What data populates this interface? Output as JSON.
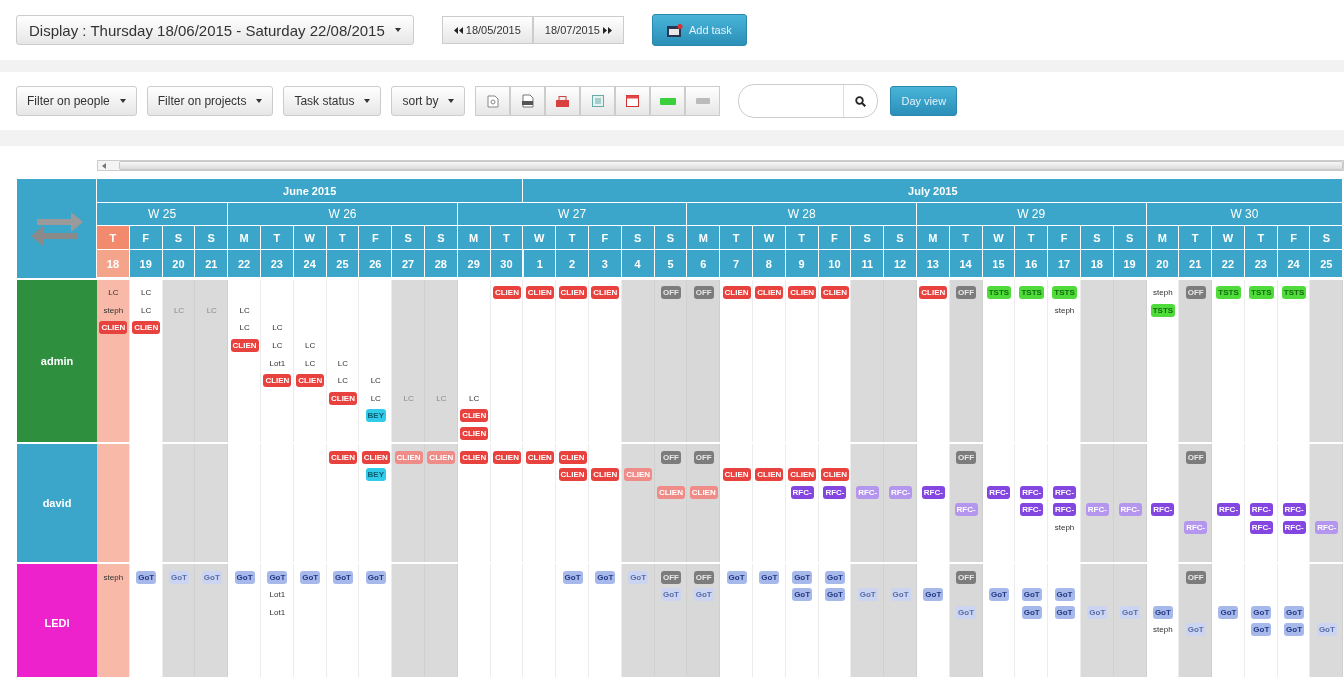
{
  "toolbar": {
    "display": "Display : Thursday 18/06/2015 - Saturday 22/08/2015",
    "prev": "18/05/2015",
    "next": "18/07/2015",
    "add_task": "Add task"
  },
  "filters": {
    "buttons": [
      "Filter on people",
      "Filter on projects",
      "Task status",
      "sort by"
    ],
    "day_view": "Day view"
  },
  "months": [
    {
      "label": "June 2015"
    },
    {
      "label": "July 2015"
    }
  ],
  "weeks": [
    {
      "label": "W 25",
      "days": [
        {
          "letter": "T",
          "number": "18",
          "weekend": false,
          "day_off": false,
          "today": true,
          "month_start": true
        },
        {
          "letter": "F",
          "number": "19",
          "weekend": false,
          "day_off": false,
          "today": false,
          "month_start": false
        },
        {
          "letter": "S",
          "number": "20",
          "weekend": true,
          "day_off": false,
          "today": false,
          "month_start": false
        },
        {
          "letter": "S",
          "number": "21",
          "weekend": true,
          "day_off": false,
          "today": false,
          "month_start": false
        }
      ]
    },
    {
      "label": "W 26",
      "days": [
        {
          "letter": "M",
          "number": "22",
          "weekend": false,
          "day_off": false,
          "today": false,
          "month_start": false
        },
        {
          "letter": "T",
          "number": "23",
          "weekend": false,
          "day_off": false,
          "today": false,
          "month_start": false
        },
        {
          "letter": "W",
          "number": "24",
          "weekend": false,
          "day_off": false,
          "today": false,
          "month_start": false
        },
        {
          "letter": "T",
          "number": "25",
          "weekend": false,
          "day_off": false,
          "today": false,
          "month_start": false
        },
        {
          "letter": "F",
          "number": "26",
          "weekend": false,
          "day_off": false,
          "today": false,
          "month_start": false
        },
        {
          "letter": "S",
          "number": "27",
          "weekend": true,
          "day_off": false,
          "today": false,
          "month_start": false
        },
        {
          "letter": "S",
          "number": "28",
          "weekend": true,
          "day_off": false,
          "today": false,
          "month_start": false
        }
      ]
    },
    {
      "label": "W 27",
      "days": [
        {
          "letter": "M",
          "number": "29",
          "weekend": false,
          "day_off": false,
          "today": false,
          "month_start": false
        },
        {
          "letter": "T",
          "number": "30",
          "weekend": false,
          "day_off": false,
          "today": false,
          "month_start": false
        },
        {
          "letter": "W",
          "number": "1",
          "weekend": false,
          "day_off": false,
          "today": false,
          "month_start": true
        },
        {
          "letter": "T",
          "number": "2",
          "weekend": false,
          "day_off": false,
          "today": false,
          "month_start": false
        },
        {
          "letter": "F",
          "number": "3",
          "weekend": false,
          "day_off": false,
          "today": false,
          "month_start": false
        },
        {
          "letter": "S",
          "number": "4",
          "weekend": true,
          "day_off": false,
          "today": false,
          "month_start": false
        },
        {
          "letter": "S",
          "number": "5",
          "weekend": true,
          "day_off": false,
          "today": false,
          "month_start": false
        }
      ]
    },
    {
      "label": "W 28",
      "days": [
        {
          "letter": "M",
          "number": "6",
          "weekend": false,
          "day_off": true,
          "today": false,
          "month_start": false
        },
        {
          "letter": "T",
          "number": "7",
          "weekend": false,
          "day_off": false,
          "today": false,
          "month_start": false
        },
        {
          "letter": "W",
          "number": "8",
          "weekend": false,
          "day_off": false,
          "today": false,
          "month_start": false
        },
        {
          "letter": "T",
          "number": "9",
          "weekend": false,
          "day_off": false,
          "today": false,
          "month_start": false
        },
        {
          "letter": "F",
          "number": "10",
          "weekend": false,
          "day_off": false,
          "today": false,
          "month_start": false
        },
        {
          "letter": "S",
          "number": "11",
          "weekend": true,
          "day_off": false,
          "today": false,
          "month_start": false
        },
        {
          "letter": "S",
          "number": "12",
          "weekend": true,
          "day_off": false,
          "today": false,
          "month_start": false
        }
      ]
    },
    {
      "label": "W 29",
      "days": [
        {
          "letter": "M",
          "number": "13",
          "weekend": false,
          "day_off": false,
          "today": false,
          "month_start": false
        },
        {
          "letter": "T",
          "number": "14",
          "weekend": false,
          "day_off": true,
          "today": false,
          "month_start": false
        },
        {
          "letter": "W",
          "number": "15",
          "weekend": false,
          "day_off": false,
          "today": false,
          "month_start": false
        },
        {
          "letter": "T",
          "number": "16",
          "weekend": false,
          "day_off": false,
          "today": false,
          "month_start": false
        },
        {
          "letter": "F",
          "number": "17",
          "weekend": false,
          "day_off": false,
          "today": false,
          "month_start": false
        },
        {
          "letter": "S",
          "number": "18",
          "weekend": true,
          "day_off": false,
          "today": false,
          "month_start": false
        },
        {
          "letter": "S",
          "number": "19",
          "weekend": true,
          "day_off": false,
          "today": false,
          "month_start": false
        }
      ]
    },
    {
      "label": "W 30",
      "days": [
        {
          "letter": "M",
          "number": "20",
          "weekend": false,
          "day_off": false,
          "today": false,
          "month_start": false
        },
        {
          "letter": "T",
          "number": "21",
          "weekend": false,
          "day_off": true,
          "today": false,
          "month_start": false
        },
        {
          "letter": "W",
          "number": "22",
          "weekend": false,
          "day_off": false,
          "today": false,
          "month_start": false
        },
        {
          "letter": "T",
          "number": "23",
          "weekend": false,
          "day_off": false,
          "today": false,
          "month_start": false
        },
        {
          "letter": "F",
          "number": "24",
          "weekend": false,
          "day_off": false,
          "today": false,
          "month_start": false
        },
        {
          "letter": "S",
          "number": "25",
          "weekend": true,
          "day_off": false,
          "today": false,
          "month_start": false
        }
      ]
    }
  ],
  "people": [
    {
      "name": "admin",
      "color": "#2e8f3e",
      "days": [
        [
          {
            "kind": "text",
            "text": "LC",
            "faded": false
          },
          {
            "kind": "text",
            "text": "steph",
            "faded": false
          },
          {
            "kind": "client",
            "text": "CLIEN",
            "faded": false
          }
        ],
        [
          {
            "kind": "text",
            "text": "LC",
            "faded": false
          },
          {
            "kind": "text",
            "text": "LC",
            "faded": false
          },
          {
            "kind": "client",
            "text": "CLIEN",
            "faded": false
          }
        ],
        [
          {
            "kind": "gap"
          },
          {
            "kind": "text",
            "text": "LC",
            "faded": true
          }
        ],
        [
          {
            "kind": "gap"
          },
          {
            "kind": "text",
            "text": "LC",
            "faded": true
          }
        ],
        [
          {
            "kind": "gap"
          },
          {
            "kind": "text",
            "text": "LC",
            "faded": false
          },
          {
            "kind": "text",
            "text": "LC",
            "faded": false
          },
          {
            "kind": "client",
            "text": "CLIEN",
            "faded": false
          }
        ],
        [
          {
            "kind": "gap"
          },
          {
            "kind": "gap"
          },
          {
            "kind": "text",
            "text": "LC",
            "faded": false
          },
          {
            "kind": "text",
            "text": "LC",
            "faded": false
          },
          {
            "kind": "text",
            "text": "Lot1",
            "faded": false
          },
          {
            "kind": "client",
            "text": "CLIEN",
            "faded": false
          }
        ],
        [
          {
            "kind": "gap"
          },
          {
            "kind": "gap"
          },
          {
            "kind": "gap"
          },
          {
            "kind": "text",
            "text": "LC",
            "faded": false
          },
          {
            "kind": "text",
            "text": "LC",
            "faded": false
          },
          {
            "kind": "client",
            "text": "CLIEN",
            "faded": false
          }
        ],
        [
          {
            "kind": "gap"
          },
          {
            "kind": "gap"
          },
          {
            "kind": "gap"
          },
          {
            "kind": "gap"
          },
          {
            "kind": "text",
            "text": "LC",
            "faded": false
          },
          {
            "kind": "text",
            "text": "LC",
            "faded": false
          },
          {
            "kind": "client",
            "text": "CLIEN",
            "faded": false
          }
        ],
        [
          {
            "kind": "gap"
          },
          {
            "kind": "gap"
          },
          {
            "kind": "gap"
          },
          {
            "kind": "gap"
          },
          {
            "kind": "gap"
          },
          {
            "kind": "text",
            "text": "LC",
            "faded": false
          },
          {
            "kind": "text",
            "text": "LC",
            "faded": false
          },
          {
            "kind": "bey",
            "text": "BEY",
            "faded": false
          }
        ],
        [
          {
            "kind": "gap"
          },
          {
            "kind": "gap"
          },
          {
            "kind": "gap"
          },
          {
            "kind": "gap"
          },
          {
            "kind": "gap"
          },
          {
            "kind": "gap"
          },
          {
            "kind": "text",
            "text": "LC",
            "faded": true
          }
        ],
        [
          {
            "kind": "gap"
          },
          {
            "kind": "gap"
          },
          {
            "kind": "gap"
          },
          {
            "kind": "gap"
          },
          {
            "kind": "gap"
          },
          {
            "kind": "gap"
          },
          {
            "kind": "text",
            "text": "LC",
            "faded": true
          }
        ],
        [
          {
            "kind": "gap"
          },
          {
            "kind": "gap"
          },
          {
            "kind": "gap"
          },
          {
            "kind": "gap"
          },
          {
            "kind": "gap"
          },
          {
            "kind": "gap"
          },
          {
            "kind": "text",
            "text": "LC",
            "faded": false
          },
          {
            "kind": "client",
            "text": "CLIEN",
            "faded": false
          },
          {
            "kind": "client",
            "text": "CLIEN",
            "faded": false
          }
        ],
        [
          {
            "kind": "client",
            "text": "CLIEN",
            "faded": false
          }
        ],
        [
          {
            "kind": "client",
            "text": "CLIEN",
            "faded": false
          }
        ],
        [
          {
            "kind": "client",
            "text": "CLIEN",
            "faded": false
          }
        ],
        [
          {
            "kind": "client",
            "text": "CLIEN",
            "faded": false
          }
        ],
        [
          {
            "kind": "gap"
          }
        ],
        [
          {
            "kind": "off",
            "text": "OFF",
            "faded": false
          }
        ],
        [
          {
            "kind": "off",
            "text": "OFF",
            "faded": false
          }
        ],
        [
          {
            "kind": "client",
            "text": "CLIEN",
            "faded": false
          }
        ],
        [
          {
            "kind": "client",
            "text": "CLIEN",
            "faded": false
          }
        ],
        [
          {
            "kind": "client",
            "text": "CLIEN",
            "faded": false
          }
        ],
        [
          {
            "kind": "client",
            "text": "CLIEN",
            "faded": false
          }
        ],
        [
          {
            "kind": "gap"
          }
        ],
        [
          {
            "kind": "gap"
          }
        ],
        [
          {
            "kind": "client",
            "text": "CLIEN",
            "faded": false
          }
        ],
        [
          {
            "kind": "off",
            "text": "OFF",
            "faded": false
          }
        ],
        [
          {
            "kind": "tsts",
            "text": "TSTS",
            "faded": false
          }
        ],
        [
          {
            "kind": "tsts",
            "text": "TSTS",
            "faded": false
          }
        ],
        [
          {
            "kind": "tsts",
            "text": "TSTS",
            "faded": false
          },
          {
            "kind": "text",
            "text": "steph",
            "faded": false
          }
        ],
        [
          {
            "kind": "gap"
          }
        ],
        [
          {
            "kind": "gap"
          }
        ],
        [
          {
            "kind": "text",
            "text": "steph",
            "faded": false
          },
          {
            "kind": "tsts",
            "text": "TSTS",
            "faded": false
          }
        ],
        [
          {
            "kind": "off",
            "text": "OFF",
            "faded": false
          }
        ],
        [
          {
            "kind": "tsts",
            "text": "TSTS",
            "faded": false
          }
        ],
        [
          {
            "kind": "tsts",
            "text": "TSTS",
            "faded": false
          }
        ],
        [
          {
            "kind": "tsts",
            "text": "TSTS",
            "faded": false
          }
        ],
        [
          {
            "kind": "gap"
          }
        ]
      ]
    },
    {
      "name": "david",
      "color": "#3ba6c9",
      "days": [
        [
          {
            "kind": "gap"
          }
        ],
        [
          {
            "kind": "gap"
          }
        ],
        [
          {
            "kind": "gap"
          }
        ],
        [
          {
            "kind": "gap"
          }
        ],
        [
          {
            "kind": "gap"
          }
        ],
        [
          {
            "kind": "gap"
          }
        ],
        [
          {
            "kind": "gap"
          }
        ],
        [
          {
            "kind": "client",
            "text": "CLIEN",
            "faded": false
          }
        ],
        [
          {
            "kind": "client",
            "text": "CLIEN",
            "faded": false
          },
          {
            "kind": "bey",
            "text": "BEY",
            "faded": false
          }
        ],
        [
          {
            "kind": "client",
            "text": "CLIEN",
            "faded": true
          }
        ],
        [
          {
            "kind": "client",
            "text": "CLIEN",
            "faded": true
          }
        ],
        [
          {
            "kind": "client",
            "text": "CLIEN",
            "faded": false
          }
        ],
        [
          {
            "kind": "client",
            "text": "CLIEN",
            "faded": false
          }
        ],
        [
          {
            "kind": "client",
            "text": "CLIEN",
            "faded": false
          }
        ],
        [
          {
            "kind": "client",
            "text": "CLIEN",
            "faded": false
          },
          {
            "kind": "client",
            "text": "CLIEN",
            "faded": false
          }
        ],
        [
          {
            "kind": "gap"
          },
          {
            "kind": "client",
            "text": "CLIEN",
            "faded": false
          }
        ],
        [
          {
            "kind": "gap"
          },
          {
            "kind": "client",
            "text": "CLIEN",
            "faded": true
          }
        ],
        [
          {
            "kind": "off",
            "text": "OFF",
            "faded": false
          },
          {
            "kind": "gap"
          },
          {
            "kind": "client",
            "text": "CLIEN",
            "faded": true
          }
        ],
        [
          {
            "kind": "off",
            "text": "OFF",
            "faded": false
          },
          {
            "kind": "gap"
          },
          {
            "kind": "client",
            "text": "CLIEN",
            "faded": true
          }
        ],
        [
          {
            "kind": "gap"
          },
          {
            "kind": "client",
            "text": "CLIEN",
            "faded": false
          }
        ],
        [
          {
            "kind": "gap"
          },
          {
            "kind": "client",
            "text": "CLIEN",
            "faded": false
          }
        ],
        [
          {
            "kind": "gap"
          },
          {
            "kind": "client",
            "text": "CLIEN",
            "faded": false
          },
          {
            "kind": "rfc",
            "text": "RFC-",
            "faded": false
          }
        ],
        [
          {
            "kind": "gap"
          },
          {
            "kind": "client",
            "text": "CLIEN",
            "faded": false
          },
          {
            "kind": "rfc",
            "text": "RFC-",
            "faded": false
          }
        ],
        [
          {
            "kind": "gap"
          },
          {
            "kind": "gap"
          },
          {
            "kind": "rfc",
            "text": "RFC-",
            "faded": true
          }
        ],
        [
          {
            "kind": "gap"
          },
          {
            "kind": "gap"
          },
          {
            "kind": "rfc",
            "text": "RFC-",
            "faded": true
          }
        ],
        [
          {
            "kind": "gap"
          },
          {
            "kind": "gap"
          },
          {
            "kind": "rfc",
            "text": "RFC-",
            "faded": false
          }
        ],
        [
          {
            "kind": "off",
            "text": "OFF",
            "faded": false
          },
          {
            "kind": "gap"
          },
          {
            "kind": "gap"
          },
          {
            "kind": "rfc",
            "text": "RFC-",
            "faded": true
          }
        ],
        [
          {
            "kind": "gap"
          },
          {
            "kind": "gap"
          },
          {
            "kind": "rfc",
            "text": "RFC-",
            "faded": false
          }
        ],
        [
          {
            "kind": "gap"
          },
          {
            "kind": "gap"
          },
          {
            "kind": "rfc",
            "text": "RFC-",
            "faded": false
          },
          {
            "kind": "rfc",
            "text": "RFC-",
            "faded": false
          }
        ],
        [
          {
            "kind": "gap"
          },
          {
            "kind": "gap"
          },
          {
            "kind": "rfc",
            "text": "RFC-",
            "faded": false
          },
          {
            "kind": "rfc",
            "text": "RFC-",
            "faded": false
          },
          {
            "kind": "text",
            "text": "steph",
            "faded": false
          }
        ],
        [
          {
            "kind": "gap"
          },
          {
            "kind": "gap"
          },
          {
            "kind": "gap"
          },
          {
            "kind": "rfc",
            "text": "RFC-",
            "faded": true
          }
        ],
        [
          {
            "kind": "gap"
          },
          {
            "kind": "gap"
          },
          {
            "kind": "gap"
          },
          {
            "kind": "rfc",
            "text": "RFC-",
            "faded": true
          }
        ],
        [
          {
            "kind": "gap"
          },
          {
            "kind": "gap"
          },
          {
            "kind": "gap"
          },
          {
            "kind": "rfc",
            "text": "RFC-",
            "faded": false
          }
        ],
        [
          {
            "kind": "off",
            "text": "OFF",
            "faded": false
          },
          {
            "kind": "gap"
          },
          {
            "kind": "gap"
          },
          {
            "kind": "gap"
          },
          {
            "kind": "rfc",
            "text": "RFC-",
            "faded": true
          }
        ],
        [
          {
            "kind": "gap"
          },
          {
            "kind": "gap"
          },
          {
            "kind": "gap"
          },
          {
            "kind": "rfc",
            "text": "RFC-",
            "faded": false
          }
        ],
        [
          {
            "kind": "gap"
          },
          {
            "kind": "gap"
          },
          {
            "kind": "gap"
          },
          {
            "kind": "rfc",
            "text": "RFC-",
            "faded": false
          },
          {
            "kind": "rfc",
            "text": "RFC-",
            "faded": false
          }
        ],
        [
          {
            "kind": "gap"
          },
          {
            "kind": "gap"
          },
          {
            "kind": "gap"
          },
          {
            "kind": "rfc",
            "text": "RFC-",
            "faded": false
          },
          {
            "kind": "rfc",
            "text": "RFC-",
            "faded": false
          }
        ],
        [
          {
            "kind": "gap"
          },
          {
            "kind": "gap"
          },
          {
            "kind": "gap"
          },
          {
            "kind": "gap"
          },
          {
            "kind": "rfc",
            "text": "RFC-",
            "faded": true
          }
        ]
      ]
    },
    {
      "name": "LEDI",
      "color": "#ee22cc",
      "days": [
        [
          {
            "kind": "text",
            "text": "steph",
            "faded": false
          }
        ],
        [
          {
            "kind": "got",
            "text": "GoT",
            "faded": false
          }
        ],
        [
          {
            "kind": "got",
            "text": "GoT",
            "faded": true
          }
        ],
        [
          {
            "kind": "got",
            "text": "GoT",
            "faded": true
          }
        ],
        [
          {
            "kind": "got",
            "text": "GoT",
            "faded": false
          }
        ],
        [
          {
            "kind": "got",
            "text": "GoT",
            "faded": false
          },
          {
            "kind": "text",
            "text": "Lot1",
            "faded": false
          },
          {
            "kind": "text",
            "text": "Lot1",
            "faded": false
          }
        ],
        [
          {
            "kind": "got",
            "text": "GoT",
            "faded": false
          }
        ],
        [
          {
            "kind": "got",
            "text": "GoT",
            "faded": false
          }
        ],
        [
          {
            "kind": "got",
            "text": "GoT",
            "faded": false
          }
        ],
        [
          {
            "kind": "gap"
          }
        ],
        [
          {
            "kind": "gap"
          }
        ],
        [
          {
            "kind": "gap"
          }
        ],
        [
          {
            "kind": "gap"
          }
        ],
        [
          {
            "kind": "gap"
          }
        ],
        [
          {
            "kind": "got",
            "text": "GoT",
            "faded": false
          }
        ],
        [
          {
            "kind": "got",
            "text": "GoT",
            "faded": false
          }
        ],
        [
          {
            "kind": "got",
            "text": "GoT",
            "faded": true
          }
        ],
        [
          {
            "kind": "off",
            "text": "OFF",
            "faded": false
          },
          {
            "kind": "got",
            "text": "GoT",
            "faded": true
          }
        ],
        [
          {
            "kind": "off",
            "text": "OFF",
            "faded": false
          },
          {
            "kind": "got",
            "text": "GoT",
            "faded": true
          }
        ],
        [
          {
            "kind": "got",
            "text": "GoT",
            "faded": false
          }
        ],
        [
          {
            "kind": "got",
            "text": "GoT",
            "faded": false
          }
        ],
        [
          {
            "kind": "got",
            "text": "GoT",
            "faded": false
          },
          {
            "kind": "got",
            "text": "GoT",
            "faded": false
          }
        ],
        [
          {
            "kind": "got",
            "text": "GoT",
            "faded": false
          },
          {
            "kind": "got",
            "text": "GoT",
            "faded": false
          }
        ],
        [
          {
            "kind": "gap"
          },
          {
            "kind": "got",
            "text": "GoT",
            "faded": true
          }
        ],
        [
          {
            "kind": "gap"
          },
          {
            "kind": "got",
            "text": "GoT",
            "faded": true
          }
        ],
        [
          {
            "kind": "gap"
          },
          {
            "kind": "got",
            "text": "GoT",
            "faded": false
          }
        ],
        [
          {
            "kind": "off",
            "text": "OFF",
            "faded": false
          },
          {
            "kind": "gap"
          },
          {
            "kind": "got",
            "text": "GoT",
            "faded": true
          }
        ],
        [
          {
            "kind": "gap"
          },
          {
            "kind": "got",
            "text": "GoT",
            "faded": false
          }
        ],
        [
          {
            "kind": "gap"
          },
          {
            "kind": "got",
            "text": "GoT",
            "faded": false
          },
          {
            "kind": "got",
            "text": "GoT",
            "faded": false
          }
        ],
        [
          {
            "kind": "gap"
          },
          {
            "kind": "got",
            "text": "GoT",
            "faded": false
          },
          {
            "kind": "got",
            "text": "GoT",
            "faded": false
          }
        ],
        [
          {
            "kind": "gap"
          },
          {
            "kind": "gap"
          },
          {
            "kind": "got",
            "text": "GoT",
            "faded": true
          }
        ],
        [
          {
            "kind": "gap"
          },
          {
            "kind": "gap"
          },
          {
            "kind": "got",
            "text": "GoT",
            "faded": true
          }
        ],
        [
          {
            "kind": "gap"
          },
          {
            "kind": "gap"
          },
          {
            "kind": "got",
            "text": "GoT",
            "faded": false
          },
          {
            "kind": "text",
            "text": "steph",
            "faded": false
          }
        ],
        [
          {
            "kind": "off",
            "text": "OFF",
            "faded": false
          },
          {
            "kind": "gap"
          },
          {
            "kind": "gap"
          },
          {
            "kind": "got",
            "text": "GoT",
            "faded": true
          }
        ],
        [
          {
            "kind": "gap"
          },
          {
            "kind": "gap"
          },
          {
            "kind": "got",
            "text": "GoT",
            "faded": false
          }
        ],
        [
          {
            "kind": "gap"
          },
          {
            "kind": "gap"
          },
          {
            "kind": "got",
            "text": "GoT",
            "faded": false
          },
          {
            "kind": "got",
            "text": "GoT",
            "faded": false
          }
        ],
        [
          {
            "kind": "gap"
          },
          {
            "kind": "gap"
          },
          {
            "kind": "got",
            "text": "GoT",
            "faded": false
          },
          {
            "kind": "got",
            "text": "GoT",
            "faded": false
          }
        ],
        [
          {
            "kind": "gap"
          },
          {
            "kind": "gap"
          },
          {
            "kind": "gap"
          },
          {
            "kind": "got",
            "text": "GoT",
            "faded": true
          }
        ]
      ]
    }
  ]
}
